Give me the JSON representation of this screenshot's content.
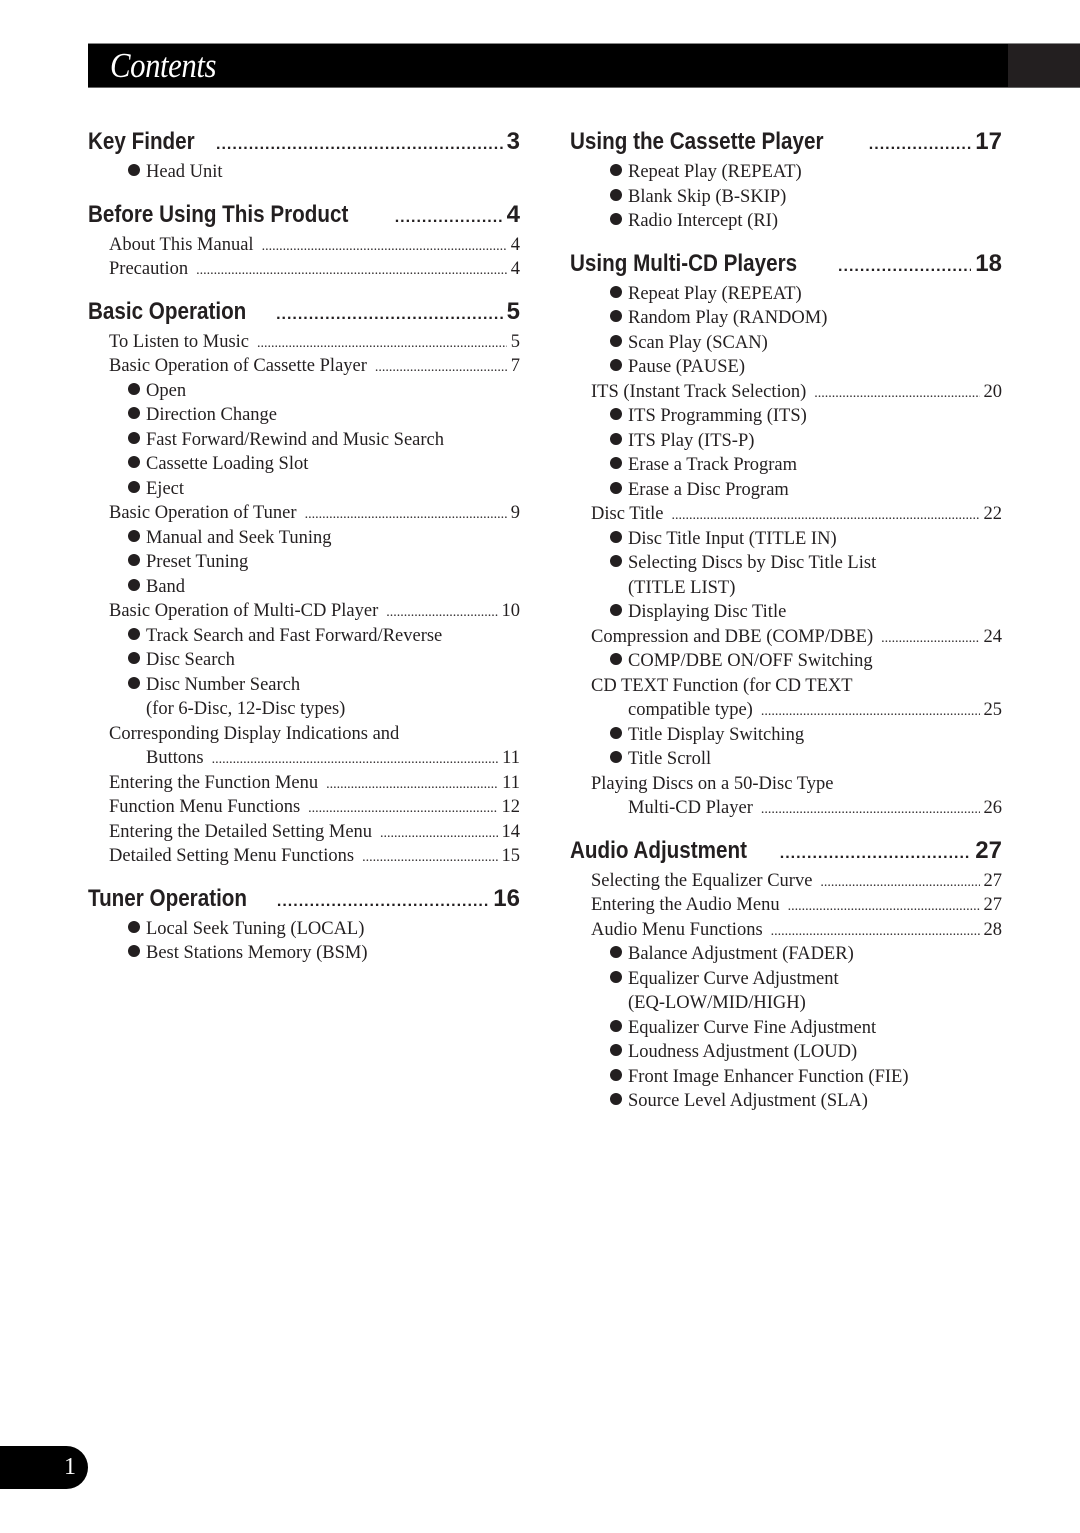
{
  "header": {
    "title": "Contents"
  },
  "page_number": "1",
  "left_column": [
    {
      "title": "Key Finder",
      "page": "3",
      "entries": [
        {
          "type": "bullet",
          "text": "Head Unit"
        }
      ]
    },
    {
      "title": "Before Using This Product",
      "page": "4",
      "entries": [
        {
          "type": "item",
          "text": "About This Manual",
          "page": "4"
        },
        {
          "type": "item",
          "text": "Precaution",
          "page": "4"
        }
      ]
    },
    {
      "title": "Basic Operation",
      "page": "5",
      "entries": [
        {
          "type": "item",
          "text": "To Listen to Music",
          "page": "5"
        },
        {
          "type": "item",
          "text": "Basic Operation of Cassette Player",
          "page": "7"
        },
        {
          "type": "bullet",
          "text": "Open"
        },
        {
          "type": "bullet",
          "text": "Direction Change"
        },
        {
          "type": "bullet",
          "text": "Fast Forward/Rewind and Music Search"
        },
        {
          "type": "bullet",
          "text": "Cassette Loading Slot"
        },
        {
          "type": "bullet",
          "text": "Eject"
        },
        {
          "type": "item",
          "text": "Basic Operation of Tuner",
          "page": "9"
        },
        {
          "type": "bullet",
          "text": "Manual and Seek Tuning"
        },
        {
          "type": "bullet",
          "text": "Preset Tuning"
        },
        {
          "type": "bullet",
          "text": "Band"
        },
        {
          "type": "item",
          "text": "Basic Operation of Multi-CD Player",
          "page": "10"
        },
        {
          "type": "bullet",
          "text": "Track Search and Fast Forward/Reverse"
        },
        {
          "type": "bullet",
          "text": "Disc Search"
        },
        {
          "type": "bullet",
          "text": "Disc Number Search"
        },
        {
          "type": "bullet-cont",
          "text": "(for 6-Disc, 12-Disc types)"
        },
        {
          "type": "item-text",
          "text": "Corresponding Display Indications and"
        },
        {
          "type": "item-cont",
          "text": "Buttons",
          "page": "11"
        },
        {
          "type": "item",
          "text": "Entering the Function Menu",
          "page": "11"
        },
        {
          "type": "item",
          "text": "Function Menu Functions",
          "page": "12"
        },
        {
          "type": "item",
          "text": "Entering the Detailed Setting Menu",
          "page": "14"
        },
        {
          "type": "item",
          "text": "Detailed Setting Menu Functions",
          "page": "15"
        }
      ]
    },
    {
      "title": "Tuner Operation",
      "page": "16",
      "entries": [
        {
          "type": "bullet",
          "text": "Local Seek Tuning (LOCAL)"
        },
        {
          "type": "bullet",
          "text": "Best Stations Memory (BSM)"
        }
      ]
    }
  ],
  "right_column": [
    {
      "title": "Using the Cassette Player",
      "page": "17",
      "entries": [
        {
          "type": "bullet",
          "text": "Repeat Play (REPEAT)"
        },
        {
          "type": "bullet",
          "text": "Blank Skip (B-SKIP)"
        },
        {
          "type": "bullet",
          "text": "Radio Intercept (RI)"
        }
      ]
    },
    {
      "title": "Using Multi-CD Players",
      "page": "18",
      "entries": [
        {
          "type": "bullet",
          "text": "Repeat Play (REPEAT)"
        },
        {
          "type": "bullet",
          "text": "Random Play (RANDOM)"
        },
        {
          "type": "bullet",
          "text": "Scan Play (SCAN)"
        },
        {
          "type": "bullet",
          "text": "Pause (PAUSE)"
        },
        {
          "type": "item",
          "text": "ITS (Instant Track Selection)",
          "page": "20"
        },
        {
          "type": "bullet",
          "text": "ITS Programming (ITS)"
        },
        {
          "type": "bullet",
          "text": "ITS Play (ITS-P)"
        },
        {
          "type": "bullet",
          "text": "Erase a Track Program"
        },
        {
          "type": "bullet",
          "text": "Erase a Disc Program"
        },
        {
          "type": "item",
          "text": "Disc Title",
          "page": "22"
        },
        {
          "type": "bullet",
          "text": "Disc Title Input (TITLE IN)"
        },
        {
          "type": "bullet",
          "text": "Selecting Discs by Disc Title List"
        },
        {
          "type": "bullet-cont",
          "text": "(TITLE LIST)"
        },
        {
          "type": "bullet",
          "text": "Displaying Disc Title"
        },
        {
          "type": "item",
          "text": "Compression and DBE (COMP/DBE)",
          "page": "24"
        },
        {
          "type": "bullet",
          "text": "COMP/DBE ON/OFF Switching"
        },
        {
          "type": "item-text",
          "text": "CD TEXT Function (for CD TEXT"
        },
        {
          "type": "item-cont",
          "text": "compatible type)",
          "page": "25"
        },
        {
          "type": "bullet",
          "text": "Title Display Switching"
        },
        {
          "type": "bullet",
          "text": "Title Scroll"
        },
        {
          "type": "item-text",
          "text": "Playing Discs on a 50-Disc Type"
        },
        {
          "type": "item-cont",
          "text": "Multi-CD Player",
          "page": "26"
        }
      ]
    },
    {
      "title": "Audio Adjustment",
      "page": "27",
      "entries": [
        {
          "type": "item",
          "text": "Selecting the Equalizer Curve",
          "page": "27"
        },
        {
          "type": "item",
          "text": "Entering the Audio Menu",
          "page": "27"
        },
        {
          "type": "item",
          "text": "Audio Menu Functions",
          "page": "28"
        },
        {
          "type": "bullet",
          "text": "Balance Adjustment (FADER)"
        },
        {
          "type": "bullet",
          "text": "Equalizer Curve Adjustment"
        },
        {
          "type": "bullet-cont",
          "text": "(EQ-LOW/MID/HIGH)"
        },
        {
          "type": "bullet",
          "text": "Equalizer Curve Fine Adjustment"
        },
        {
          "type": "bullet",
          "text": "Loudness Adjustment (LOUD)"
        },
        {
          "type": "bullet",
          "text": "Front Image Enhancer Function (FIE)"
        },
        {
          "type": "bullet",
          "text": "Source Level Adjustment (SLA)"
        }
      ]
    }
  ]
}
